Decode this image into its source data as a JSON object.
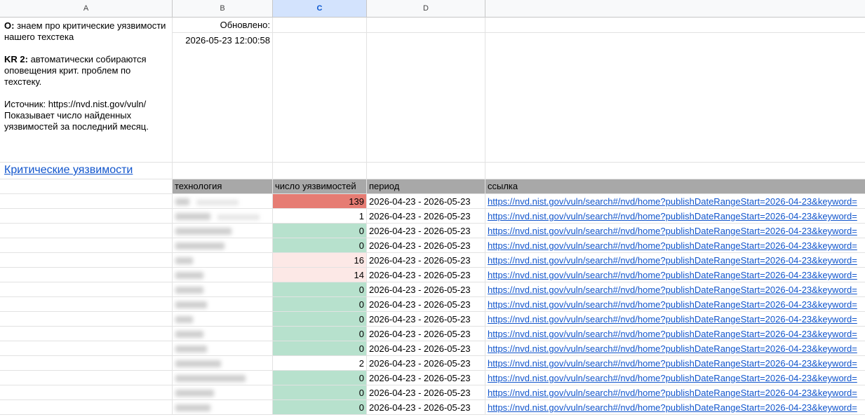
{
  "columns": [
    "A",
    "B",
    "C",
    "D"
  ],
  "selected_column": "C",
  "notes": {
    "o_label": "O:",
    "o_text": "знаем про критические уязвимости нашего техстека",
    "kr_label": "KR 2:",
    "kr_text": "автоматически собираются оповещения крит. проблем по техстеку.",
    "source_text": "Источник: https://nvd.nist.gov/vuln/ Показывает число найденных уязвимостей за последний месяц."
  },
  "updated": {
    "label": "Обновлено:",
    "value": "2026-05-23 12:00:58"
  },
  "section_title": "Критические уязвимости",
  "table": {
    "headers": [
      "технология",
      "число уязвимостей",
      "период",
      "ссылка"
    ],
    "rows": [
      {
        "count": "139",
        "status": "red",
        "period": "2026-04-23 - 2026-05-23",
        "link": "https://nvd.nist.gov/vuln/search#/nvd/home?publishDateRangeStart=2026-04-23&keyword="
      },
      {
        "count": "1",
        "status": "none",
        "period": "2026-04-23 - 2026-05-23",
        "link": "https://nvd.nist.gov/vuln/search#/nvd/home?publishDateRangeStart=2026-04-23&keyword="
      },
      {
        "count": "0",
        "status": "green",
        "period": "2026-04-23 - 2026-05-23",
        "link": "https://nvd.nist.gov/vuln/search#/nvd/home?publishDateRangeStart=2026-04-23&keyword="
      },
      {
        "count": "0",
        "status": "green",
        "period": "2026-04-23 - 2026-05-23",
        "link": "https://nvd.nist.gov/vuln/search#/nvd/home?publishDateRangeStart=2026-04-23&keyword="
      },
      {
        "count": "16",
        "status": "pink",
        "period": "2026-04-23 - 2026-05-23",
        "link": "https://nvd.nist.gov/vuln/search#/nvd/home?publishDateRangeStart=2026-04-23&keyword="
      },
      {
        "count": "14",
        "status": "pink",
        "period": "2026-04-23 - 2026-05-23",
        "link": "https://nvd.nist.gov/vuln/search#/nvd/home?publishDateRangeStart=2026-04-23&keyword="
      },
      {
        "count": "0",
        "status": "green",
        "period": "2026-04-23 - 2026-05-23",
        "link": "https://nvd.nist.gov/vuln/search#/nvd/home?publishDateRangeStart=2026-04-23&keyword="
      },
      {
        "count": "0",
        "status": "green",
        "period": "2026-04-23 - 2026-05-23",
        "link": "https://nvd.nist.gov/vuln/search#/nvd/home?publishDateRangeStart=2026-04-23&keyword="
      },
      {
        "count": "0",
        "status": "green",
        "period": "2026-04-23 - 2026-05-23",
        "link": "https://nvd.nist.gov/vuln/search#/nvd/home?publishDateRangeStart=2026-04-23&keyword="
      },
      {
        "count": "0",
        "status": "green",
        "period": "2026-04-23 - 2026-05-23",
        "link": "https://nvd.nist.gov/vuln/search#/nvd/home?publishDateRangeStart=2026-04-23&keyword="
      },
      {
        "count": "0",
        "status": "green",
        "period": "2026-04-23 - 2026-05-23",
        "link": "https://nvd.nist.gov/vuln/search#/nvd/home?publishDateRangeStart=2026-04-23&keyword="
      },
      {
        "count": "2",
        "status": "none",
        "period": "2026-04-23 - 2026-05-23",
        "link": "https://nvd.nist.gov/vuln/search#/nvd/home?publishDateRangeStart=2026-04-23&keyword="
      },
      {
        "count": "0",
        "status": "green",
        "period": "2026-04-23 - 2026-05-23",
        "link": "https://nvd.nist.gov/vuln/search#/nvd/home?publishDateRangeStart=2026-04-23&keyword="
      },
      {
        "count": "0",
        "status": "green",
        "period": "2026-04-23 - 2026-05-23",
        "link": "https://nvd.nist.gov/vuln/search#/nvd/home?publishDateRangeStart=2026-04-23&keyword="
      },
      {
        "count": "0",
        "status": "green",
        "period": "2026-04-23 - 2026-05-23",
        "link": "https://nvd.nist.gov/vuln/search#/nvd/home?publishDateRangeStart=2026-04-23&keyword="
      }
    ]
  }
}
